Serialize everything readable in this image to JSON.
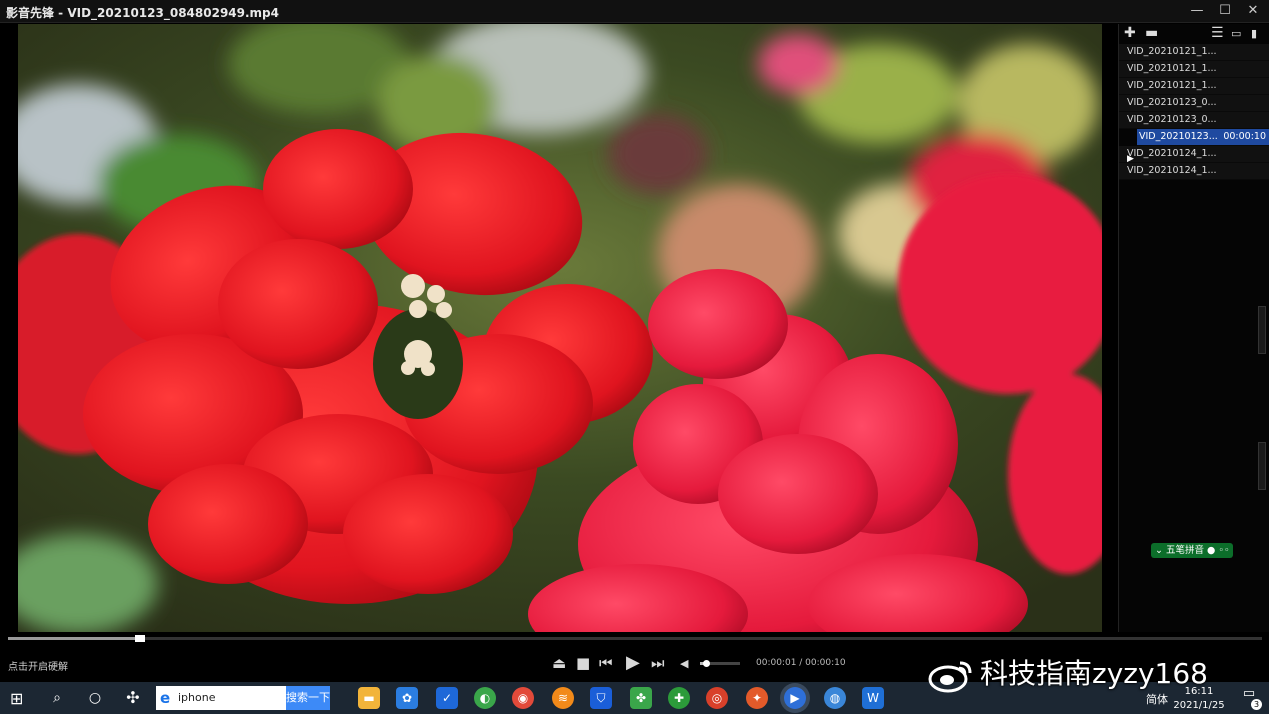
{
  "window": {
    "title": "影音先锋 - VID_20210123_084802949.mp4"
  },
  "playlist": {
    "items": [
      {
        "name": "VID_20210121_1...",
        "duration": ""
      },
      {
        "name": "VID_20210121_1...",
        "duration": ""
      },
      {
        "name": "VID_20210121_1...",
        "duration": ""
      },
      {
        "name": "VID_20210123_0...",
        "duration": ""
      },
      {
        "name": "VID_20210123_0...",
        "duration": ""
      },
      {
        "name": "VID_20210123...",
        "duration": "00:00:10"
      },
      {
        "name": "VID_20210124_1...",
        "duration": ""
      },
      {
        "name": "VID_20210124_1...",
        "duration": ""
      }
    ],
    "active_index": 5
  },
  "ime": {
    "label": "五笔拼音"
  },
  "player": {
    "hint": "点击开启硬解",
    "time": "00:00:01 / 00:00:10",
    "progress_fraction": 0.105,
    "volume_fraction": 0.15
  },
  "taskbar": {
    "search_value": "iphone",
    "search_button": "搜索一下",
    "clock_time": "16:11",
    "clock_date": "2021/1/25",
    "ime_tray": "简体",
    "notification_count": "3"
  },
  "watermark": {
    "text": "科技指南zyzy168"
  },
  "colors": {
    "accent": "#1f4aa0",
    "ime_green": "#0c6e2a",
    "search_blue": "#3d8af7"
  }
}
